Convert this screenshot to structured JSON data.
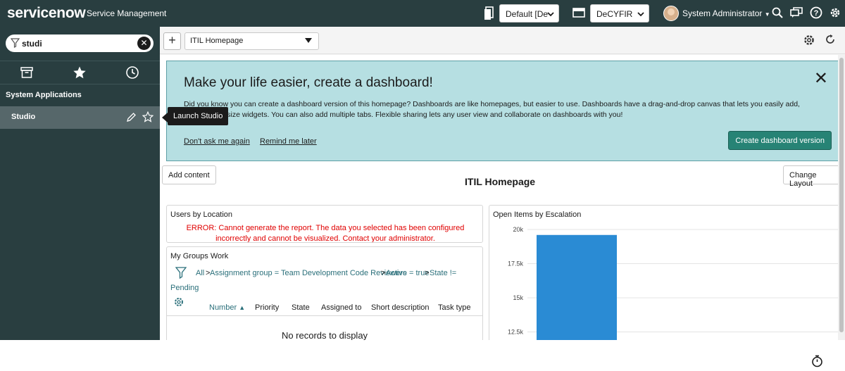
{
  "header": {
    "logo_text": "servicenow",
    "product_name": "Service Management",
    "update_set_select": "Default [De",
    "application_select": "DeCYFIR",
    "user_name": "System Administrator"
  },
  "sidebar": {
    "search_value": "studi",
    "section_title": "System Applications",
    "module_label": "Studio",
    "tooltip": "Launch Studio"
  },
  "toolbar": {
    "add_label": "+",
    "homepage_select": "ITIL Homepage"
  },
  "banner": {
    "title": "Make your life easier, create a dashboard!",
    "text": "Did you know you can create a dashboard version of this homepage? Dashboards are like homepages, but easier to use. Dashboards have a drag-and-drop canvas that lets you easily add, move, and resize widgets. You can also add multiple tabs. Flexible sharing lets any user view and collaborate on dashboards with you!",
    "dont_ask": "Don't ask me again",
    "remind_later": "Remind me later",
    "create_button": "Create dashboard version",
    "close_label": "✕"
  },
  "page": {
    "add_content": "Add content",
    "change_layout": "Change Layout",
    "title": "ITIL Homepage"
  },
  "widgets": {
    "users_by_location": {
      "title": "Users by Location",
      "error": "ERROR: Cannot generate the report. The data you selected has been configured incorrectly and cannot be visualized. Contact your administrator."
    },
    "my_groups_work": {
      "title": "My Groups Work",
      "crumb_all": "All",
      "crumb_sep": ">",
      "crumb_1": "Assignment group = Team Development Code Reviewers",
      "crumb_2": "Active = true",
      "crumb_3": "State !=",
      "crumb_3b": "Pending",
      "columns": [
        "Number",
        "Priority",
        "State",
        "Assigned to",
        "Short description",
        "Task type"
      ],
      "sort_arrow": "▲",
      "empty": "No records to display"
    },
    "open_items": {
      "title": "Open Items by Escalation"
    }
  },
  "chart_data": {
    "type": "bar",
    "title": "Open Items by Escalation",
    "yticks": [
      "20k",
      "17.5k",
      "15k",
      "12.5k"
    ],
    "categories": [
      ""
    ],
    "values": [
      19600
    ],
    "ylim_visible": [
      11600,
      20600
    ],
    "colors": [
      "#2a8bd4"
    ]
  },
  "colors": {
    "header_bg": "#293e40",
    "accent_green": "#278375",
    "banner_bg": "#b6dfe2",
    "error_red": "#e00000"
  }
}
